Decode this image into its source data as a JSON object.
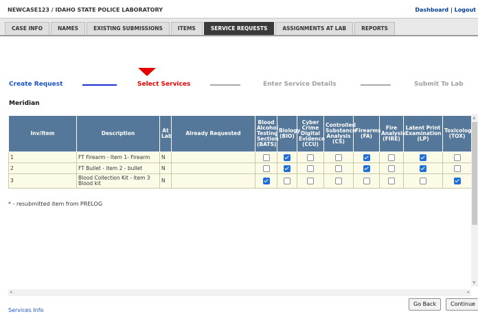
{
  "header": {
    "case_title": "NEWCASE123 / IDAHO STATE POLICE LABORATORY",
    "dashboard_link": "Dashboard",
    "separator": "|",
    "logout_link": "Logout"
  },
  "tabs": [
    {
      "label": "CASE INFO",
      "active": false
    },
    {
      "label": "NAMES",
      "active": false
    },
    {
      "label": "EXISTING SUBMISSIONS",
      "active": false
    },
    {
      "label": "ITEMS",
      "active": false
    },
    {
      "label": "SERVICE REQUESTS",
      "active": true
    },
    {
      "label": "ASSIGNMENTS AT LAB",
      "active": false
    },
    {
      "label": "REPORTS",
      "active": false
    }
  ],
  "wizard": {
    "steps": [
      "Create Request",
      "Select Services",
      "Enter Service Details",
      "Submit To Lab"
    ],
    "current_step": "Select Services"
  },
  "location": "Meridian",
  "table": {
    "headers": [
      "Inv/Item",
      "Description",
      "At Lab",
      "Already Requested",
      "Blood Alcohol Testing Section (BATS)",
      "Biology (BIO)",
      "Cyber Crime Digital Evidence (CCU)",
      "Controlled Substance Analysis (CS)",
      "Firearms (FA)",
      "Fire Analysis (FIRE)",
      "Latent Print Examination (LP)",
      "Toxicology (TOX)"
    ],
    "rows": [
      {
        "inv": "1",
        "description": "FT Firearm - Item 1- Firearm",
        "at_lab": "N",
        "already_requested": "",
        "checks": [
          false,
          true,
          false,
          false,
          true,
          false,
          true,
          false
        ]
      },
      {
        "inv": "2",
        "description": "FT Bullet - item 2 - bullet",
        "at_lab": "N",
        "already_requested": "",
        "checks": [
          false,
          true,
          false,
          false,
          true,
          false,
          true,
          false
        ]
      },
      {
        "inv": "3",
        "description": "Blood Collection Kit - item 3 Blood kit",
        "at_lab": "N",
        "already_requested": "",
        "checks": [
          true,
          false,
          false,
          false,
          false,
          false,
          false,
          true
        ]
      }
    ]
  },
  "note": "* - resubmitted item from PRELOG",
  "buttons": {
    "go_back": "Go Back",
    "continue": "Continue"
  },
  "footer_link": "Services Info",
  "colors": {
    "header_bg": "#557799",
    "active_tab": "#3a3a3a",
    "current_step": "#e60000",
    "link": "#1a53c7"
  }
}
